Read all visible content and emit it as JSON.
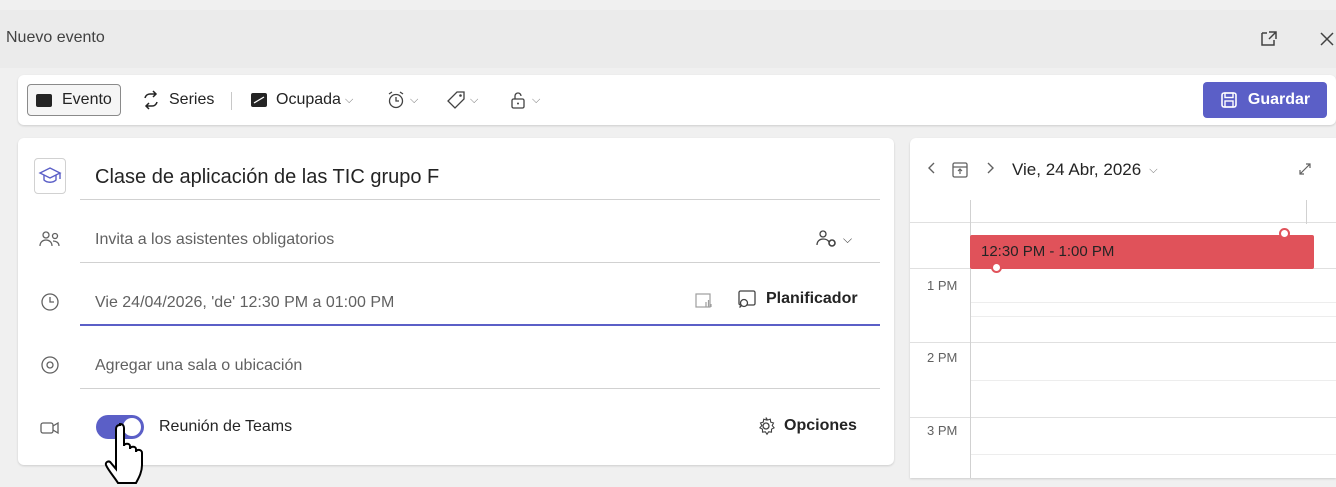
{
  "window": {
    "title": "Nuevo evento"
  },
  "toolbar": {
    "evento_label": "Evento",
    "series_label": "Series",
    "busy_label": "Ocupada",
    "save_label": "Guardar",
    "accent_color": "#5b5fc7"
  },
  "form": {
    "title_value": "Clase de aplicación de las TIC grupo F",
    "attendees_placeholder": "Invita a los asistentes obligatorios",
    "datetime_value": "Vie 24/04/2026, 'de' 12:30 PM a 01:00 PM",
    "scheduler_label": "Planificador",
    "location_placeholder": "Agregar una sala o ubicación",
    "teams_label": "Reunión de Teams",
    "teams_enabled": true,
    "options_label": "Opciones"
  },
  "calendar": {
    "date_label": "Vie, 24 Abr, 2026",
    "event_time": "12:30 PM - 1:00 PM",
    "event_color": "#e0525a",
    "hours": [
      "1 PM",
      "2 PM",
      "3 PM"
    ]
  }
}
